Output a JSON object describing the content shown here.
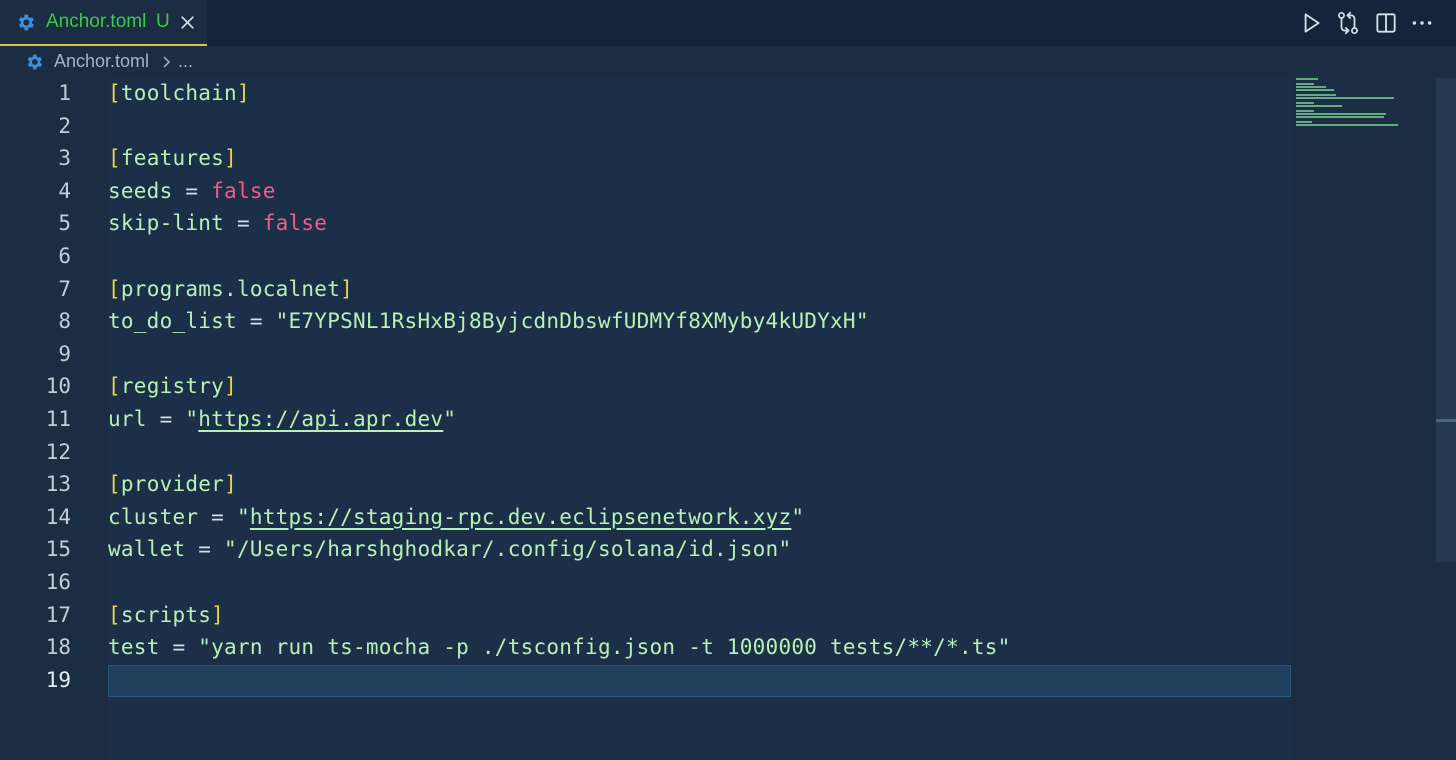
{
  "tab": {
    "filename": "Anchor.toml",
    "status": "U"
  },
  "breadcrumb": {
    "file": "Anchor.toml",
    "more": "..."
  },
  "toolbar": {
    "icons": [
      "run-icon",
      "compare-changes-icon",
      "split-editor-icon",
      "more-actions-icon"
    ]
  },
  "colors": {
    "tab_text": "#3ec94d",
    "active_tab_border": "#e5c33c",
    "bracket": "#e8d24a",
    "keyword_false": "#f25b8e",
    "text": "#b8f0b5",
    "background": "#1b2d42"
  },
  "editor": {
    "current_line": 19,
    "lines": [
      {
        "n": "1",
        "tokens": [
          {
            "t": "[",
            "c": "bracket"
          },
          {
            "t": "toolchain",
            "c": "section"
          },
          {
            "t": "]",
            "c": "bracket"
          }
        ]
      },
      {
        "n": "2",
        "tokens": []
      },
      {
        "n": "3",
        "tokens": [
          {
            "t": "[",
            "c": "bracket"
          },
          {
            "t": "features",
            "c": "section"
          },
          {
            "t": "]",
            "c": "bracket"
          }
        ]
      },
      {
        "n": "4",
        "tokens": [
          {
            "t": "seeds",
            "c": "key"
          },
          {
            "t": " = ",
            "c": "op"
          },
          {
            "t": "false",
            "c": "bool"
          }
        ]
      },
      {
        "n": "5",
        "tokens": [
          {
            "t": "skip-lint",
            "c": "key"
          },
          {
            "t": " = ",
            "c": "op"
          },
          {
            "t": "false",
            "c": "bool"
          }
        ]
      },
      {
        "n": "6",
        "tokens": []
      },
      {
        "n": "7",
        "tokens": [
          {
            "t": "[",
            "c": "bracket"
          },
          {
            "t": "programs.localnet",
            "c": "section"
          },
          {
            "t": "]",
            "c": "bracket"
          }
        ]
      },
      {
        "n": "8",
        "tokens": [
          {
            "t": "to_do_list",
            "c": "key"
          },
          {
            "t": " = ",
            "c": "op"
          },
          {
            "t": "\"E7YPSNL1RsHxBj8ByjcdnDbswfUDMYf8XMyby4kUDYxH\"",
            "c": "str"
          }
        ]
      },
      {
        "n": "9",
        "tokens": []
      },
      {
        "n": "10",
        "tokens": [
          {
            "t": "[",
            "c": "bracket"
          },
          {
            "t": "registry",
            "c": "section"
          },
          {
            "t": "]",
            "c": "bracket"
          }
        ]
      },
      {
        "n": "11",
        "tokens": [
          {
            "t": "url",
            "c": "key"
          },
          {
            "t": " = ",
            "c": "op"
          },
          {
            "t": "\"",
            "c": "str"
          },
          {
            "t": "https://api.apr.dev",
            "c": "url"
          },
          {
            "t": "\"",
            "c": "str"
          }
        ]
      },
      {
        "n": "12",
        "tokens": []
      },
      {
        "n": "13",
        "tokens": [
          {
            "t": "[",
            "c": "bracket"
          },
          {
            "t": "provider",
            "c": "section"
          },
          {
            "t": "]",
            "c": "bracket"
          }
        ]
      },
      {
        "n": "14",
        "tokens": [
          {
            "t": "cluster",
            "c": "key"
          },
          {
            "t": " = ",
            "c": "op"
          },
          {
            "t": "\"",
            "c": "str"
          },
          {
            "t": "https://staging-rpc.dev.eclipsenetwork.xyz",
            "c": "url"
          },
          {
            "t": "\"",
            "c": "str"
          }
        ]
      },
      {
        "n": "15",
        "tokens": [
          {
            "t": "wallet",
            "c": "key"
          },
          {
            "t": " = ",
            "c": "op"
          },
          {
            "t": "\"/Users/harshghodkar/.config/solana/id.json\"",
            "c": "str"
          }
        ]
      },
      {
        "n": "16",
        "tokens": []
      },
      {
        "n": "17",
        "tokens": [
          {
            "t": "[",
            "c": "bracket"
          },
          {
            "t": "scripts",
            "c": "section"
          },
          {
            "t": "]",
            "c": "bracket"
          }
        ]
      },
      {
        "n": "18",
        "tokens": [
          {
            "t": "test",
            "c": "key"
          },
          {
            "t": " = ",
            "c": "op"
          },
          {
            "t": "\"yarn run ts-mocha -p ./tsconfig.json -t 1000000 tests/**/*.ts\"",
            "c": "str"
          }
        ]
      },
      {
        "n": "19",
        "tokens": []
      }
    ]
  }
}
